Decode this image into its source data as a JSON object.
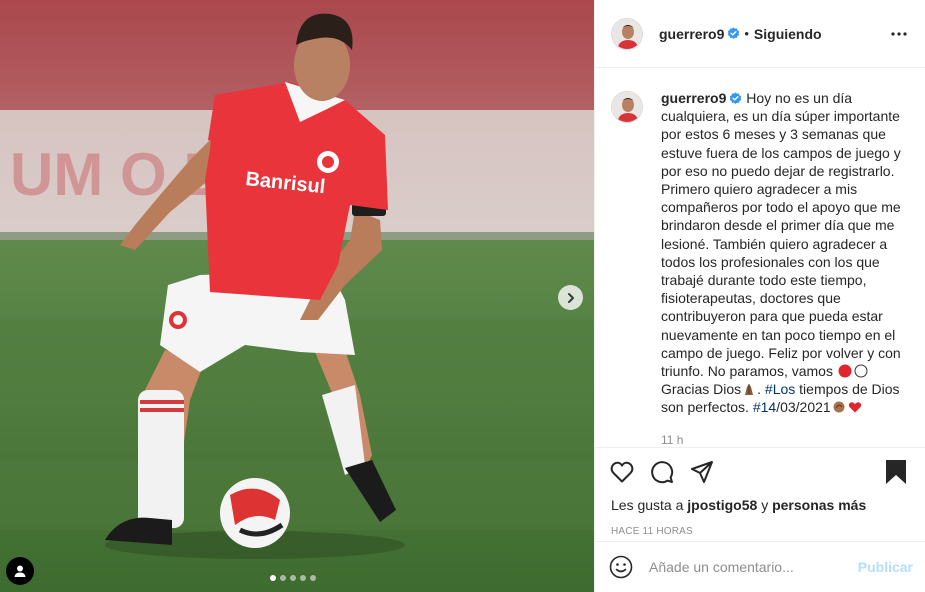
{
  "post": {
    "username": "guerrero9",
    "follow_status": "Siguiendo",
    "separator": "•",
    "caption": {
      "part1": "Hoy no es un día cualquiera, es un día súper importante por estos 6 meses y 3 semanas que estuve fuera de los campos de juego y por eso no puedo dejar de registrarlo. Primero quiero agradecer a mis compañeros por todo el apoyo que me brindaron desde el primer día que me lesioné. También quiero agradecer a todos los profesionales con los que trabajé durante todo este tiempo, fisioterapeutas, doctores que contribuyeron para que pueda estar nuevamente en tan poco tiempo en el campo de juego. Feliz por volver y con triunfo. No paramos, vamos",
      "part2": "Gracias Dios",
      "part3": ".",
      "hashtag1": "#Los",
      "part4": " tiempos de Dios son perfectos.",
      "hashtag2": "#14",
      "part5": "/03/2021"
    },
    "comment_time": "11 h",
    "likes": {
      "prefix": "Les gusta a",
      "user": "jpostigo58",
      "connector": "y",
      "others": "personas más"
    },
    "posted_ago": "HACE 11 HORAS",
    "comment_placeholder": "Añade un comentario...",
    "publish_label": "Publicar"
  },
  "carousel": {
    "slides": 5,
    "active_index": 0
  },
  "icons": {
    "verified": "verified-badge-icon",
    "more": "more-options-icon",
    "like": "heart-icon",
    "comment": "comment-icon",
    "share": "share-icon",
    "save": "bookmark-icon",
    "emoji": "emoji-icon",
    "next": "chevron-right-icon",
    "tags": "user-tag-icon"
  },
  "colors": {
    "accent": "#0095f6",
    "verified": "#3897f0",
    "hashtag": "#00376b",
    "muted": "#8e8e8e",
    "publish_disabled": "#b2dffc"
  }
}
